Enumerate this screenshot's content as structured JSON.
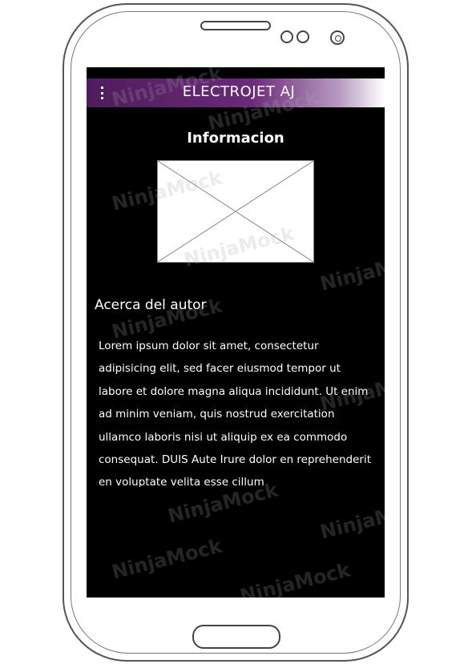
{
  "app": {
    "title": "ELECTROJET AJ",
    "menu_icon": "more-vert-icon"
  },
  "main": {
    "section_title": "Informacion",
    "image_placeholder_icon": "image-placeholder-icon",
    "about_title": "Acerca del autor",
    "about_text": "Lorem ipsum dolor sit amet, consectetur adipisicing elit, sed facer eiusmod tempor ut labore et dolore magna aliqua incididunt. Ut enim ad minim veniam, quis nostrud exercitation ullamco laboris nisi ut aliquip ex ea commodo consequat. DUIS Aute Irure dolor en reprehenderit en voluptate velita esse cillum"
  },
  "watermark": {
    "text": "NinjaMock"
  },
  "colors": {
    "appbar_start": "#4e1c5c",
    "screen_background": "#000000",
    "text": "#ffffff"
  }
}
